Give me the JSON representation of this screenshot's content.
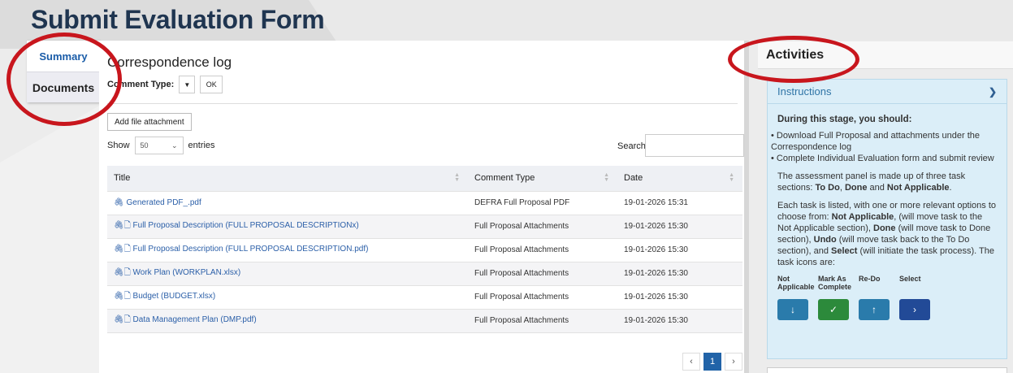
{
  "page": {
    "title": "Submit Evaluation Form"
  },
  "side_tabs": [
    {
      "label": "Summary",
      "active": true
    },
    {
      "label": "Documents",
      "active": false
    }
  ],
  "main": {
    "title": "Correspondence log",
    "comment_type_label": "Comment Type:",
    "comment_type_value": "",
    "ok_label": "OK",
    "attach_label": "Add file attachment",
    "show_label": "Show",
    "entries_value": "50",
    "entries_label": "entries",
    "search_label": "Search",
    "search_value": "",
    "table": {
      "columns": [
        "Title",
        "Comment Type",
        "Date"
      ],
      "rows": [
        {
          "title": "Generated PDF_.pdf",
          "has_doc_icon": false,
          "type": "DEFRA Full Proposal PDF",
          "date": "19-01-2026 15:31"
        },
        {
          "title": "Full Proposal Description (FULL PROPOSAL DESCRIPTIONx)",
          "has_doc_icon": true,
          "type": "Full Proposal Attachments",
          "date": "19-01-2026 15:30"
        },
        {
          "title": "Full Proposal Description (FULL PROPOSAL DESCRIPTION.pdf)",
          "has_doc_icon": true,
          "type": "Full Proposal Attachments",
          "date": "19-01-2026 15:30"
        },
        {
          "title": "Work Plan (WORKPLAN.xlsx)",
          "has_doc_icon": true,
          "type": "Full Proposal Attachments",
          "date": "19-01-2026 15:30"
        },
        {
          "title": "Budget (BUDGET.xlsx)",
          "has_doc_icon": true,
          "type": "Full Proposal Attachments",
          "date": "19-01-2026 15:30"
        },
        {
          "title": "Data Management Plan (DMP.pdf)",
          "has_doc_icon": true,
          "type": "Full Proposal Attachments",
          "date": "19-01-2026 15:30"
        }
      ]
    },
    "pagination": {
      "prev": "‹",
      "current": "1",
      "next": "›"
    }
  },
  "activities": {
    "title": "Activities",
    "instructions_title": "Instructions",
    "heading": "During this stage, you should:",
    "bullets": [
      "Download Full Proposal and attachments under the Correspondence log",
      "Complete Individual Evaluation form and submit review"
    ],
    "para1_pre": "The assessment panel is made up of three task sections: ",
    "para1_b1": "To Do",
    "para1_mid1": ", ",
    "para1_b2": "Done",
    "para1_mid2": " and ",
    "para1_b3": "Not Applicable",
    "para1_end": ".",
    "para2": {
      "t1": "Each task is listed, with one or more relevant options to choose from: ",
      "b1": "Not Applicable",
      "t2": ", (will move task to the Not Applicable section), ",
      "b2": "Done",
      "t3": " (will move task to Done section), ",
      "b3": "Undo",
      "t4": " (will move task back to the To Do section), and ",
      "b4": "Select",
      "t5": " (will initiate the task process). The task icons are:"
    },
    "icons": [
      {
        "label": "Not Applicable",
        "glyph": "↓"
      },
      {
        "label": "Mark As Complete",
        "glyph": "✓"
      },
      {
        "label": "Re-Do",
        "glyph": "↑"
      },
      {
        "label": "Select",
        "glyph": "›"
      }
    ]
  },
  "colors": {
    "accent": "#2163a8",
    "annotation_red": "#c8161d",
    "title": "#1f3550"
  }
}
